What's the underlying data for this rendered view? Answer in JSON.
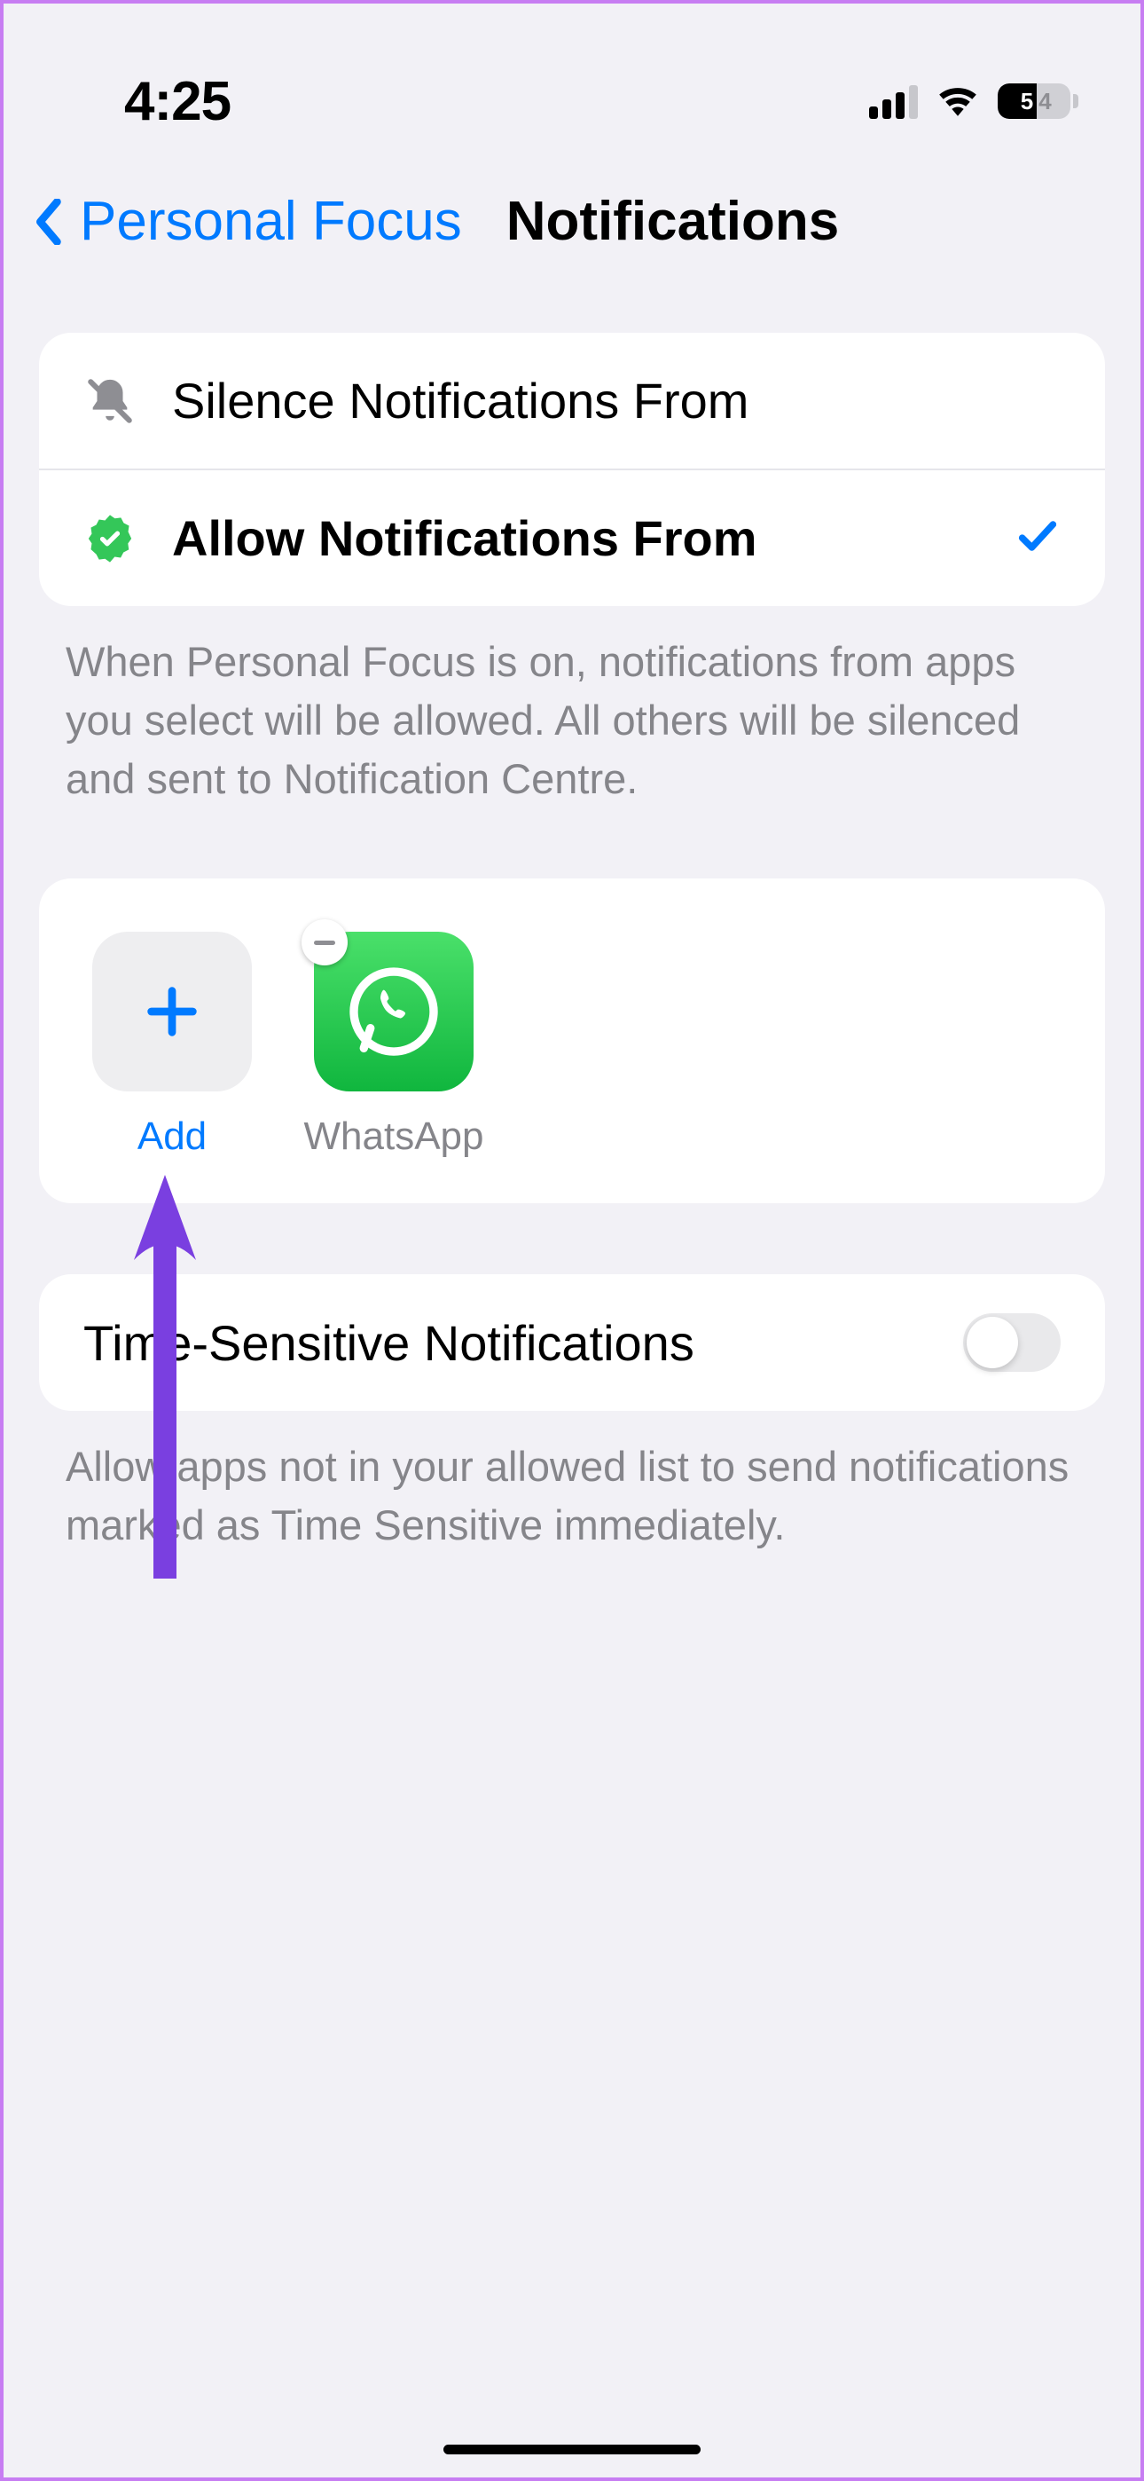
{
  "status": {
    "time": "4:25",
    "battery_percent": "54",
    "battery_d1": "5",
    "battery_d2": "4"
  },
  "nav": {
    "back_label": "Personal Focus",
    "title": "Notifications"
  },
  "mode_group": {
    "silence_label": "Silence Notifications From",
    "allow_label": "Allow Notifications From",
    "selected": "allow",
    "footer": "When Personal Focus is on, notifications from apps you select will be allowed. All others will be silenced and sent to Notification Centre."
  },
  "apps": {
    "add_label": "Add",
    "items": [
      {
        "name": "WhatsApp"
      }
    ]
  },
  "time_sensitive": {
    "label": "Time-Sensitive Notifications",
    "enabled": false,
    "footer": "Allow apps not in your allowed list to send notifications marked as Time Sensitive immediately."
  }
}
